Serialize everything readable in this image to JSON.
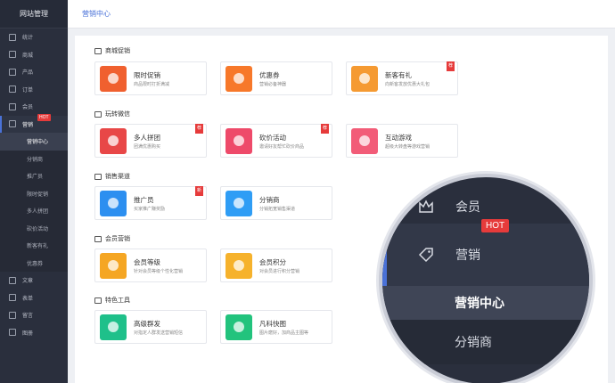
{
  "app": {
    "title": "网站管理"
  },
  "header": {
    "breadcrumb": "营销中心"
  },
  "sidebar": {
    "items": [
      {
        "label": "统计"
      },
      {
        "label": "商城"
      },
      {
        "label": "产品"
      },
      {
        "label": "订单"
      },
      {
        "label": "会员"
      },
      {
        "label": "营销",
        "badge": "HOT"
      }
    ],
    "subitems": [
      {
        "label": "营销中心"
      },
      {
        "label": "分销商"
      },
      {
        "label": "推广员"
      },
      {
        "label": "限时促销"
      },
      {
        "label": "多人拼团"
      },
      {
        "label": "砍价活动"
      },
      {
        "label": "新客有礼"
      },
      {
        "label": "优惠券"
      }
    ],
    "bottom_items": [
      {
        "label": "文章"
      },
      {
        "label": "表单"
      },
      {
        "label": "留言"
      },
      {
        "label": "图册"
      }
    ]
  },
  "sections": [
    {
      "title": "商城促销",
      "cards": [
        {
          "title": "限时促销",
          "desc": "商品限时打折满减",
          "color": "#f0602f"
        },
        {
          "title": "优惠券",
          "desc": "营销必备神器",
          "color": "#f7782a"
        },
        {
          "title": "新客有礼",
          "desc": "向新客发放优惠大礼包",
          "color": "#f59a32",
          "tag": "荐"
        }
      ]
    },
    {
      "title": "玩转微信",
      "cards": [
        {
          "title": "多人拼团",
          "desc": "团满优惠购买",
          "color": "#e84747",
          "tag": "荐"
        },
        {
          "title": "砍价活动",
          "desc": "邀请好友帮忙砍价商品",
          "color": "#ee4a6a",
          "tag": "荐"
        },
        {
          "title": "互动游戏",
          "desc": "超级大转盘等游戏营销",
          "color": "#f25c78"
        }
      ]
    },
    {
      "title": "销售渠道",
      "cards": [
        {
          "title": "推广员",
          "desc": "买家推广赚奖励",
          "color": "#2c8ff0",
          "tag": "新"
        },
        {
          "title": "分销商",
          "desc": "分销拓宽销售渠道",
          "color": "#2f9df5"
        }
      ]
    },
    {
      "title": "会员营销",
      "cards": [
        {
          "title": "会员等级",
          "desc": "针对会员等级个性化营销",
          "color": "#f5a623"
        },
        {
          "title": "会员积分",
          "desc": "对会员进行积分营销",
          "color": "#f6b22c"
        }
      ]
    },
    {
      "title": "特色工具",
      "cards": [
        {
          "title": "高级群发",
          "desc": "对指定人群发送营销短信",
          "color": "#1fc08a"
        },
        {
          "title": "凡科快图",
          "desc": "图片磨好，加商品主图等",
          "color": "#22c37d"
        }
      ]
    }
  ],
  "magnifier": {
    "rows": [
      {
        "label": "会员"
      },
      {
        "label": "营销",
        "badge": "HOT"
      },
      {
        "label": "营销中心"
      },
      {
        "label": "分销商"
      }
    ]
  },
  "colors": {
    "accent": "#4a72d8",
    "sidebar": "#2a2f3d",
    "hot": "#e63b3b"
  }
}
